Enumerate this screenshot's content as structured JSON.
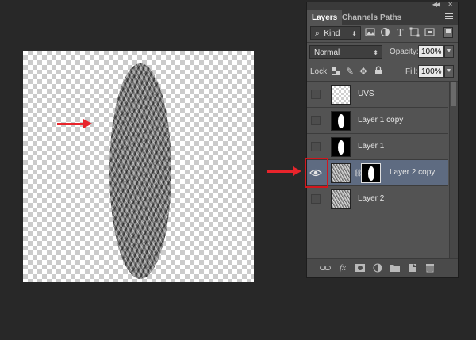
{
  "panel": {
    "collapse_glyph": "◀◀",
    "close_glyph": "✕",
    "tabs": [
      {
        "label": "Layers",
        "active": true
      },
      {
        "label": "Channels",
        "active": false
      },
      {
        "label": "Paths",
        "active": false
      }
    ]
  },
  "filter": {
    "kind_label": "Kind",
    "icons": [
      "image-filter-icon",
      "adjustment-filter-icon",
      "type-filter-icon",
      "shape-filter-icon",
      "smart-object-filter-icon"
    ]
  },
  "blend": {
    "mode": "Normal",
    "opacity_label": "Opacity:",
    "opacity_value": "100%"
  },
  "lock": {
    "label": "Lock:",
    "fill_label": "Fill:",
    "fill_value": "100%"
  },
  "layers": [
    {
      "name": "UVS",
      "visible": false,
      "selected": false,
      "thumb": "check",
      "mask": null
    },
    {
      "name": "Layer 1 copy",
      "visible": false,
      "selected": false,
      "thumb": "black",
      "mask": null
    },
    {
      "name": "Layer 1",
      "visible": false,
      "selected": false,
      "thumb": "black",
      "mask": null
    },
    {
      "name": "Layer 2 copy",
      "visible": true,
      "selected": true,
      "thumb": "tex",
      "mask": "black"
    },
    {
      "name": "Layer 2",
      "visible": false,
      "selected": false,
      "thumb": "tex",
      "mask": null
    }
  ],
  "bottom_icons": [
    "link-layers-icon",
    "fx-icon",
    "add-mask-icon",
    "adjustment-layer-icon",
    "new-group-icon",
    "new-layer-icon",
    "delete-layer-icon"
  ],
  "bottom_fx_label": "fx",
  "colors": {
    "annotation_red": "#e8242b",
    "selected_row": "#5e6b81",
    "panel_bg": "#535353",
    "workspace_bg": "#282828"
  }
}
